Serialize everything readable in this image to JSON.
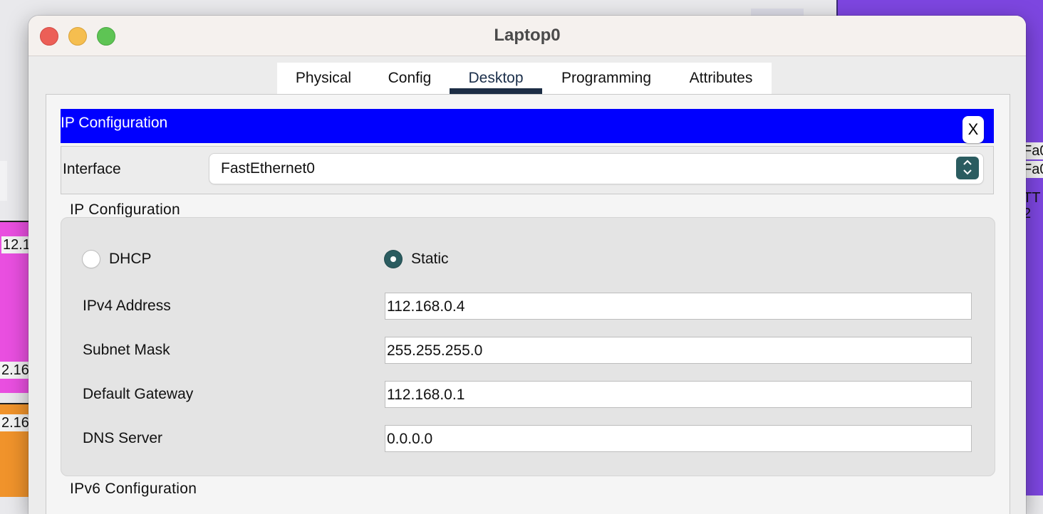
{
  "window": {
    "title": "Laptop0"
  },
  "tabs": [
    "Physical",
    "Config",
    "Desktop",
    "Programming",
    "Attributes"
  ],
  "active_tab": "Desktop",
  "ip_config": {
    "header_title": "IP Configuration",
    "close_label": "X",
    "interface_label": "Interface",
    "interface_value": "FastEthernet0",
    "section_ipv4": "IP Configuration",
    "dhcp_label": "DHCP",
    "static_label": "Static",
    "mode": "Static",
    "fields": [
      {
        "label": "IPv4 Address",
        "value": "112.168.0.4"
      },
      {
        "label": "Subnet Mask",
        "value": "255.255.255.0"
      },
      {
        "label": "Default Gateway",
        "value": "112.168.0.1"
      },
      {
        "label": "DNS Server",
        "value": "0.0.0.0"
      }
    ],
    "section_ipv6": "IPv6 Configuration"
  },
  "background": {
    "left_labels": [
      "12.1",
      "2.16",
      "2.16"
    ],
    "right_labels": [
      "Fa0",
      "Fa0",
      "TT",
      "2"
    ]
  },
  "colors": {
    "header_blue": "#0000ff",
    "accent_teal": "#2b5c60",
    "tab_underline": "#1c2d45",
    "workspace_purple": "#7d46e0",
    "device_pink": "#e94fe0",
    "device_orange": "#f0932b"
  },
  "icons": {
    "close": "close-icon",
    "select": "chevron-up-down-icon"
  }
}
